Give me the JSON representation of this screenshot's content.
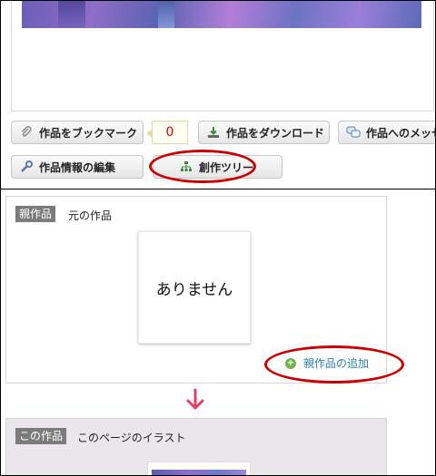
{
  "artwork_actions": {
    "bookmark_label": "作品をブックマーク",
    "bookmark_count": "0",
    "download_label": "作品をダウンロード",
    "message_label": "作品へのメッセ",
    "edit_info_label": "作品情報の編集",
    "tree_label": "創作ツリー"
  },
  "parent_section": {
    "tag": "親作品",
    "title": "元の作品",
    "empty_text": "ありません",
    "add_link_label": "親作品の追加"
  },
  "this_section": {
    "tag": "この作品",
    "title": "このページのイラスト"
  },
  "colors": {
    "highlight": "#cc0000",
    "arrow": "#e0406a",
    "link": "#2a7fb0"
  }
}
